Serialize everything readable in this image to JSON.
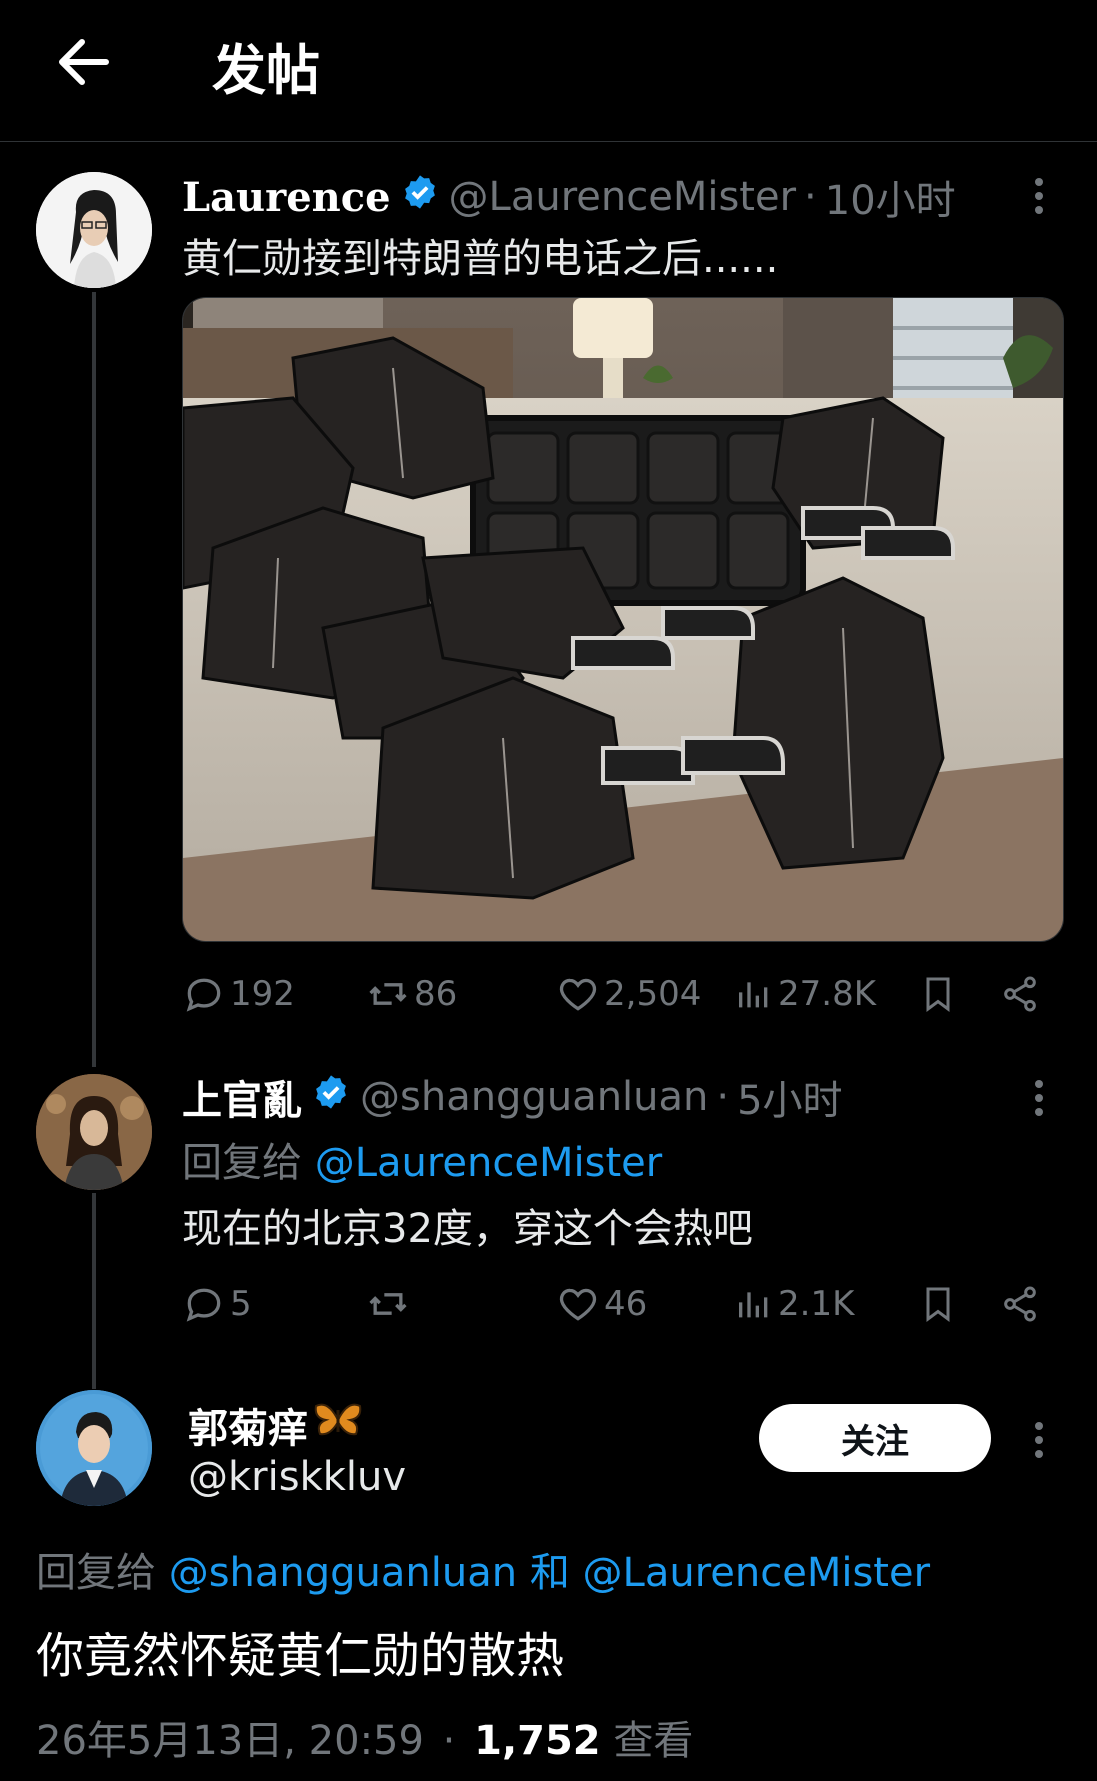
{
  "header": {
    "title": "发帖"
  },
  "post1": {
    "display_name": "Laurence",
    "handle": "@LaurenceMister",
    "separator": "·",
    "time": "10小时",
    "text": "黄仁勋接到特朗普的电话之后......",
    "stats": {
      "replies": "192",
      "reposts": "86",
      "likes": "2,504",
      "views": "27.8K"
    }
  },
  "post2": {
    "display_name": "上官亂",
    "handle": "@shangguanluan",
    "separator": "·",
    "time": "5小时",
    "reply_prefix": "回复给",
    "reply_to": "@LaurenceMister",
    "text": "现在的北京32度，穿这个会热吧",
    "stats": {
      "replies": "5",
      "reposts": "",
      "likes": "46",
      "views": "2.1K"
    }
  },
  "post3": {
    "display_name": "郭菊痒",
    "handle": "@kriskkluv",
    "follow_label": "关注",
    "reply_prefix": "回复给",
    "reply_to_1": "@shangguanluan",
    "reply_and": "和",
    "reply_to_2": "@LaurenceMister",
    "text": "你竟然怀疑黄仁勋的散热",
    "timestamp": "26年5月13日, 20:59",
    "separator": "·",
    "view_count": "1,752",
    "view_label": "查看"
  },
  "colors": {
    "accent": "#1d9bf0",
    "muted": "#71767b",
    "background": "#000000",
    "text": "#e7e9ea"
  },
  "icons": [
    "back-arrow-icon",
    "verified-badge-icon",
    "more-icon",
    "reply-icon",
    "repost-icon",
    "like-icon",
    "views-icon",
    "bookmark-icon",
    "share-icon",
    "butterfly-icon"
  ]
}
